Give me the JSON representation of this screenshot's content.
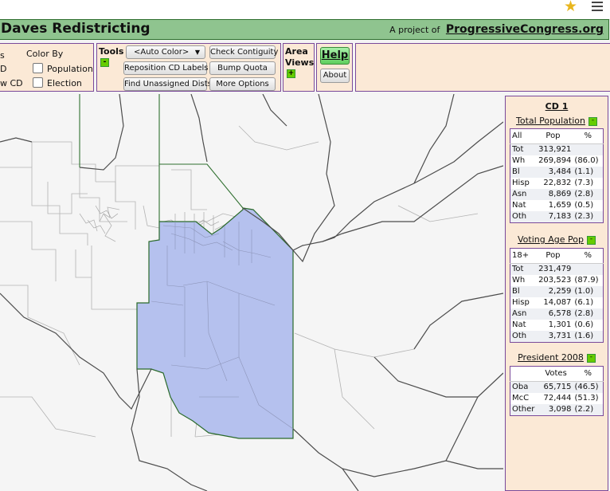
{
  "header": {
    "title": "Daves Redistricting",
    "project_prefix": "A project of",
    "project_link": "ProgressiveCongress.org"
  },
  "toolbar": {
    "left_partial": [
      "s",
      "D",
      "w CD"
    ],
    "color_by_label": "Color By",
    "color_by_options": [
      "Population",
      "Election"
    ],
    "tools_label": "Tools",
    "auto_color": "<Auto Color>",
    "reposition": "Reposition CD Labels",
    "find_unassigned": "Find Unassigned Dists",
    "check_contiguity": "Check Contiguity",
    "bump_quota": "Bump Quota",
    "more_options": "More Options",
    "area_label": "Area",
    "views_label": "Views",
    "help": "Help",
    "about": "About",
    "collapse_glyph": "-",
    "expand_glyph": "+"
  },
  "panel": {
    "cd_title": "CD 1",
    "total_pop": {
      "title": "Total Population",
      "headers": [
        "All",
        "Pop",
        "%"
      ],
      "rows": [
        [
          "Tot",
          "313,921",
          ""
        ],
        [
          "Wh",
          "269,894",
          "(86.0)"
        ],
        [
          "Bl",
          "3,484",
          "(1.1)"
        ],
        [
          "Hisp",
          "22,832",
          "(7.3)"
        ],
        [
          "Asn",
          "8,869",
          "(2.8)"
        ],
        [
          "Nat",
          "1,659",
          "(0.5)"
        ],
        [
          "Oth",
          "7,183",
          "(2.3)"
        ]
      ]
    },
    "voting_age": {
      "title": "Voting Age Pop",
      "headers": [
        "18+",
        "Pop",
        "%"
      ],
      "rows": [
        [
          "Tot",
          "231,479",
          ""
        ],
        [
          "Wh",
          "203,523",
          "(87.9)"
        ],
        [
          "Bl",
          "2,259",
          "(1.0)"
        ],
        [
          "Hisp",
          "14,087",
          "(6.1)"
        ],
        [
          "Asn",
          "6,578",
          "(2.8)"
        ],
        [
          "Nat",
          "1,301",
          "(0.6)"
        ],
        [
          "Oth",
          "3,731",
          "(1.6)"
        ]
      ]
    },
    "president": {
      "title": "President 2008",
      "headers": [
        "",
        "Votes",
        "%"
      ],
      "rows": [
        [
          "Oba",
          "65,715",
          "(46.5)"
        ],
        [
          "McC",
          "72,444",
          "(51.3)"
        ],
        [
          "Other",
          "3,098",
          "(2.2)"
        ]
      ]
    }
  },
  "colors": {
    "district_fill": "#b5c1ee",
    "district_border": "#2a6a2a",
    "county_lines": "#555555",
    "precinct_lines": "#b0b0b0"
  }
}
